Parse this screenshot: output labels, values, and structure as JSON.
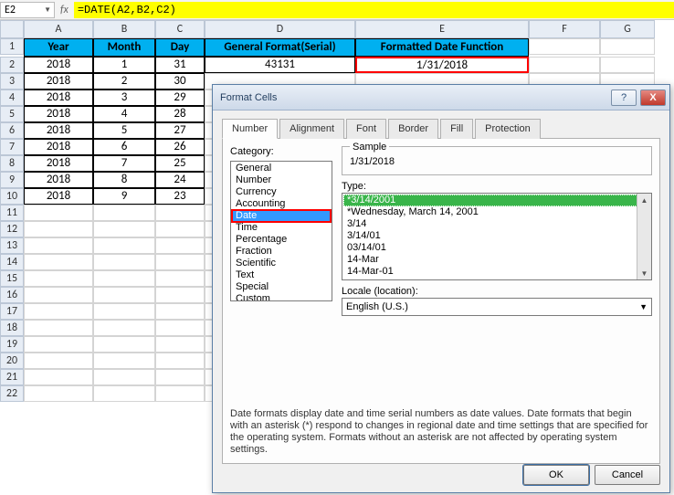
{
  "formula_bar": {
    "cell_ref": "E2",
    "formula": "=DATE(A2,B2,C2)"
  },
  "columns": [
    "A",
    "B",
    "C",
    "D",
    "E",
    "F",
    "G"
  ],
  "rows": [
    "1",
    "2",
    "3",
    "4",
    "5",
    "6",
    "7",
    "8",
    "9",
    "10",
    "11",
    "12",
    "13",
    "14",
    "15",
    "16",
    "17",
    "18",
    "19",
    "20",
    "21",
    "22"
  ],
  "headers": {
    "A": "Year",
    "B": "Month",
    "C": "Day",
    "D": "General Format(Serial)",
    "E": "Formatted Date Function"
  },
  "data": [
    {
      "year": "2018",
      "month": "1",
      "day": "31",
      "serial": "43131",
      "formatted": "1/31/2018"
    },
    {
      "year": "2018",
      "month": "2",
      "day": "30"
    },
    {
      "year": "2018",
      "month": "3",
      "day": "29"
    },
    {
      "year": "2018",
      "month": "4",
      "day": "28"
    },
    {
      "year": "2018",
      "month": "5",
      "day": "27"
    },
    {
      "year": "2018",
      "month": "6",
      "day": "26"
    },
    {
      "year": "2018",
      "month": "7",
      "day": "25"
    },
    {
      "year": "2018",
      "month": "8",
      "day": "24"
    },
    {
      "year": "2018",
      "month": "9",
      "day": "23"
    }
  ],
  "dialog": {
    "title": "Format Cells",
    "tabs": [
      "Number",
      "Alignment",
      "Font",
      "Border",
      "Fill",
      "Protection"
    ],
    "active_tab": "Number",
    "category_label": "Category:",
    "categories": [
      "General",
      "Number",
      "Currency",
      "Accounting",
      "Date",
      "Time",
      "Percentage",
      "Fraction",
      "Scientific",
      "Text",
      "Special",
      "Custom"
    ],
    "selected_category": "Date",
    "sample_label": "Sample",
    "sample_value": "1/31/2018",
    "type_label": "Type:",
    "types": [
      "*3/14/2001",
      "*Wednesday, March 14, 2001",
      "3/14",
      "3/14/01",
      "03/14/01",
      "14-Mar",
      "14-Mar-01"
    ],
    "selected_type": "*3/14/2001",
    "locale_label": "Locale (location):",
    "locale_value": "English (U.S.)",
    "description": "Date formats display date and time serial numbers as date values. Date formats that begin with an asterisk (*) respond to changes in regional date and time settings that are specified for the operating system. Formats without an asterisk are not affected by operating system settings.",
    "ok": "OK",
    "cancel": "Cancel",
    "help": "?",
    "close": "X"
  }
}
